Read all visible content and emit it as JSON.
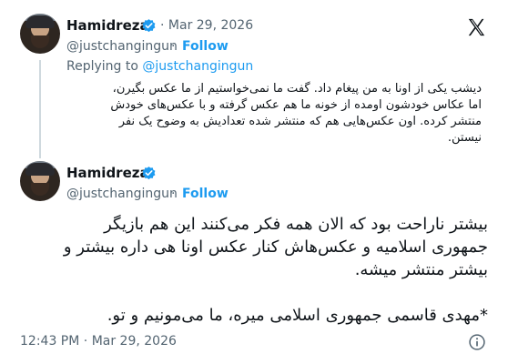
{
  "tweet_parent": {
    "author_name": "Hamidreza",
    "date": "Mar 29, 2026",
    "handle": "@justchangingun",
    "follow_label": "Follow",
    "separator": "·",
    "replying_prefix": "Replying to",
    "replying_handle": "@justchangingun",
    "body_lines": [
      "دیشب یکی از اونا به من پیغام داد. گفت ما نمی‌خواستیم از ما عکس بگیرن،",
      "اما عکاس خودشون اومده از خونه ما هم عکس گرفته و با عکس‌های خودش",
      "منتشر کرده. اون عکس‌هایی هم که منتشر شده تعدادیش به وضوح یک نفر",
      "نیستن."
    ]
  },
  "tweet_main": {
    "author_name": "Hamidreza",
    "handle": "@justchangingun",
    "follow_label": "Follow",
    "separator": "·",
    "paragraph1_lines": [
      "بیشتر ناراحت بود که الان همه فکر می‌کنند این هم بازیگر",
      "جمهوری اسلامیه و عکس‌هاش کنار عکس اونا هی داره بیشتر و",
      "بیشتر منتشر میشه."
    ],
    "paragraph2_lines": [
      "*مهدی قاسمی جمهوری اسلامی میره، ما می‌مونیم و تو."
    ],
    "time": "12:43 PM",
    "date": "Mar 29, 2026"
  },
  "colors": {
    "link_blue": "#1d9bf0",
    "secondary_text": "#536471",
    "thread_line": "#cfd9de",
    "verified_blue": "#1d9bf0"
  },
  "icons": [
    "x-logo-icon",
    "verified-badge-icon",
    "info-icon"
  ]
}
